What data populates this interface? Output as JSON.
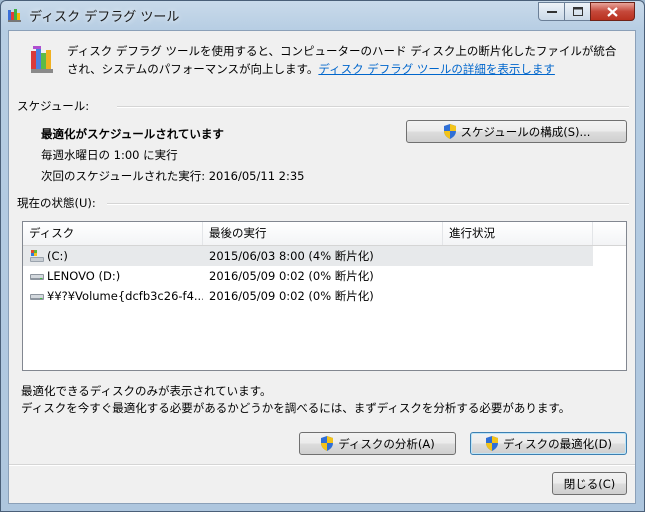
{
  "window": {
    "title": "ディスク デフラグ ツール"
  },
  "header": {
    "description": "ディスク デフラグ ツールを使用すると、コンピューターのハード ディスク上の断片化したファイルが統合され、システムのパフォーマンスが向上します。",
    "details_link": "ディスク デフラグ ツールの詳細を表示します"
  },
  "schedule": {
    "section_label": "スケジュール:",
    "status": "最適化がスケジュールされています",
    "frequency": "毎週水曜日の 1:00 に実行",
    "next_run": "次回のスケジュールされた実行: 2016/05/11 2:35",
    "configure_button": "スケジュールの構成(S)..."
  },
  "current_status": {
    "section_label": "現在の状態(U):",
    "columns": [
      "ディスク",
      "最後の実行",
      "進行状況"
    ],
    "disks": [
      {
        "name": "(C:)",
        "last_run": "2015/06/03 8:00 (4% 断片化)",
        "progress": "",
        "icon": "system-drive-icon"
      },
      {
        "name": "LENOVO (D:)",
        "last_run": "2016/05/09 0:02 (0% 断片化)",
        "progress": "",
        "icon": "hard-drive-icon"
      },
      {
        "name": "¥¥?¥Volume{dcfb3c26-f4...",
        "last_run": "2016/05/09 0:02 (0% 断片化)",
        "progress": "",
        "icon": "hard-drive-icon"
      }
    ]
  },
  "footer": {
    "note1": "最適化できるディスクのみが表示されています。",
    "note2": "ディスクを今すぐ最適化する必要があるかどうかを調べるには、まずディスクを分析する必要があります。",
    "analyze_button": "ディスクの分析(A)",
    "defrag_button": "ディスクの最適化(D)",
    "close_button": "閉じる(C)"
  },
  "colors": {
    "link": "#0066cc",
    "accent": "#3c7fb1"
  }
}
